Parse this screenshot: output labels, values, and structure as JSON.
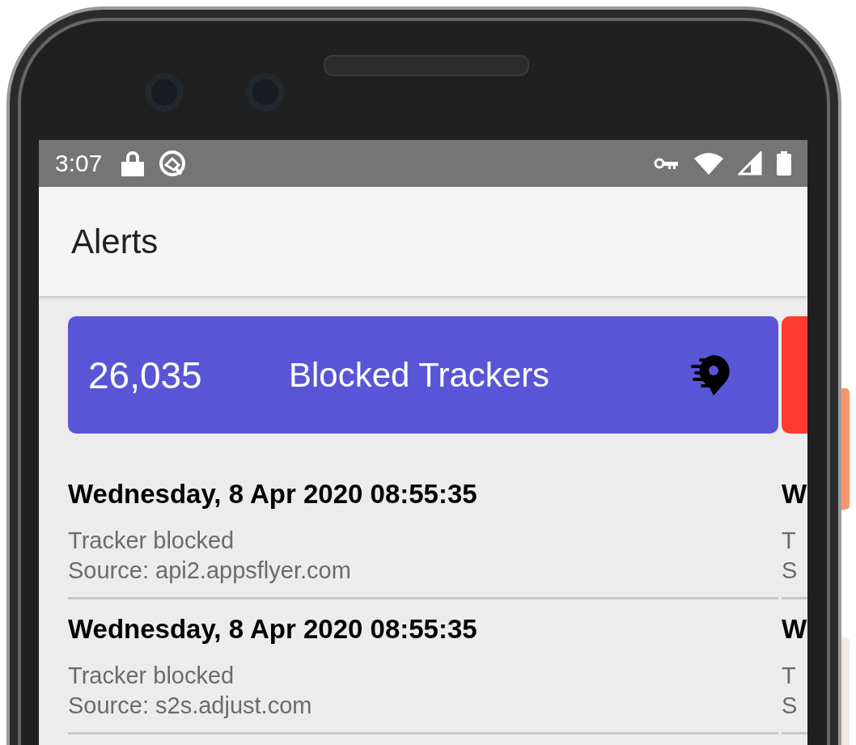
{
  "status_bar": {
    "time": "3:07"
  },
  "app_bar": {
    "title": "Alerts"
  },
  "pages": [
    {
      "color": "#5856d6",
      "count": "26,035",
      "label": "Blocked Trackers",
      "alerts": [
        {
          "title": "Wednesday, 8 Apr 2020 08:55:35",
          "lines": [
            "Tracker blocked",
            "Source: api2.appsflyer.com"
          ]
        },
        {
          "title": "Wednesday, 8 Apr 2020 08:55:35",
          "lines": [
            "Tracker blocked",
            "Source: s2s.adjust.com"
          ]
        }
      ]
    },
    {
      "color": "#ff3b30",
      "alerts": [
        {
          "title": "W",
          "lines": [
            "T",
            "S"
          ]
        },
        {
          "title": "W",
          "lines": [
            "T",
            "S"
          ]
        }
      ]
    }
  ]
}
